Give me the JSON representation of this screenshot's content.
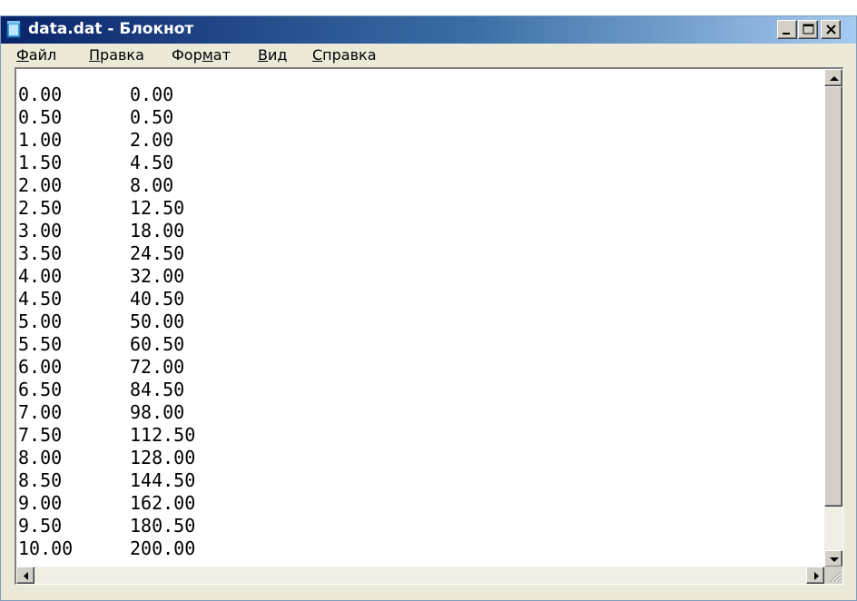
{
  "window": {
    "title": "data.dat - Блокнот",
    "icon": "notepad-icon",
    "controls": {
      "minimize": "minimize-icon",
      "maximize": "maximize-icon",
      "close": "close-icon"
    }
  },
  "menu": {
    "items": [
      {
        "prefix": "",
        "accel": "Ф",
        "rest": "айл"
      },
      {
        "prefix": "",
        "accel": "П",
        "rest": "равка"
      },
      {
        "prefix": "Фор",
        "accel": "м",
        "rest": "ат"
      },
      {
        "prefix": "",
        "accel": "В",
        "rest": "ид"
      },
      {
        "prefix": "",
        "accel": "С",
        "rest": "правка"
      }
    ]
  },
  "document": {
    "rows": [
      [
        "0.00",
        "0.00"
      ],
      [
        "0.50",
        "0.50"
      ],
      [
        "1.00",
        "2.00"
      ],
      [
        "1.50",
        "4.50"
      ],
      [
        "2.00",
        "8.00"
      ],
      [
        "2.50",
        "12.50"
      ],
      [
        "3.00",
        "18.00"
      ],
      [
        "3.50",
        "24.50"
      ],
      [
        "4.00",
        "32.00"
      ],
      [
        "4.50",
        "40.50"
      ],
      [
        "5.00",
        "50.00"
      ],
      [
        "5.50",
        "60.50"
      ],
      [
        "6.00",
        "72.00"
      ],
      [
        "6.50",
        "84.50"
      ],
      [
        "7.00",
        "98.00"
      ],
      [
        "7.50",
        "112.50"
      ],
      [
        "8.00",
        "128.00"
      ],
      [
        "8.50",
        "144.50"
      ],
      [
        "9.00",
        "162.00"
      ],
      [
        "9.50",
        "180.50"
      ],
      [
        "10.00",
        "200.00"
      ]
    ]
  },
  "colors": {
    "titlebar_start": "#0a246a",
    "titlebar_end": "#a6caf0",
    "chrome": "#ece9d8",
    "editor_bg": "#ffffff"
  }
}
